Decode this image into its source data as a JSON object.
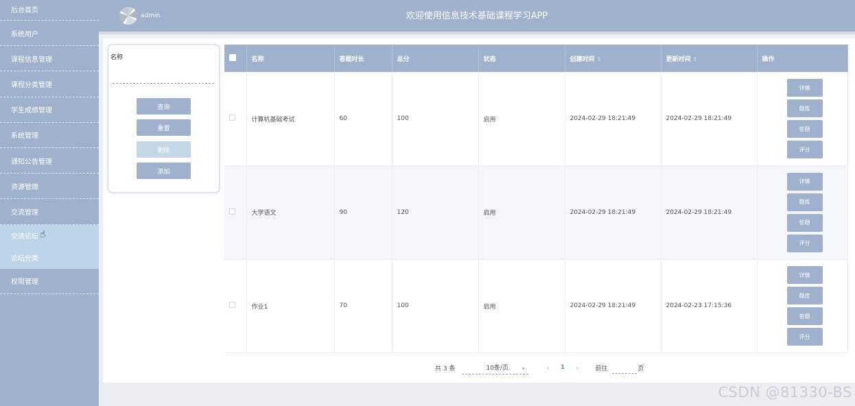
{
  "sidebar": {
    "items": [
      {
        "label": "后台首页"
      },
      {
        "label": "系统用户"
      },
      {
        "label": "课程信息管理"
      },
      {
        "label": "课程分类管理"
      },
      {
        "label": "学生成绩管理"
      },
      {
        "label": "系统管理"
      },
      {
        "label": "通知公告管理"
      },
      {
        "label": "资源管理"
      },
      {
        "label": "交流管理"
      }
    ],
    "submenu": [
      {
        "label": "交流论坛"
      },
      {
        "label": "论坛分类"
      }
    ],
    "last": {
      "label": "权限管理"
    }
  },
  "header": {
    "user": "admin",
    "title": "欢迎使用信息技术基础课程学习APP"
  },
  "search": {
    "label": "名称",
    "query_btn": "查询",
    "reset_btn": "重置",
    "delete_btn": "删除",
    "add_btn": "添加"
  },
  "table": {
    "headers": [
      "名称",
      "答题时长",
      "总分",
      "状态",
      "创建时间",
      "更新时间",
      "操作"
    ],
    "rows": [
      {
        "name": "计算机基础考试",
        "duration": "60",
        "score": "100",
        "status": "启用",
        "created": "2024-02-29 18:21:49",
        "updated": "2024-02-29 18:21:49"
      },
      {
        "name": "大学语文",
        "duration": "90",
        "score": "120",
        "status": "启用",
        "created": "2024-02-29 18:21:49",
        "updated": "2024-02-29 18:21:49"
      },
      {
        "name": "作业1",
        "duration": "70",
        "score": "100",
        "status": "启用",
        "created": "2024-02-29 18:21:49",
        "updated": "2024-02-23 17:15:36"
      }
    ],
    "ops": [
      "详情",
      "题库",
      "答题",
      "评分"
    ]
  },
  "pager": {
    "total": "共 3 条",
    "page_size": "10条/页",
    "current": "1",
    "goto": "前往",
    "page_unit": "页"
  },
  "watermark": "CSDN @81330-BS"
}
